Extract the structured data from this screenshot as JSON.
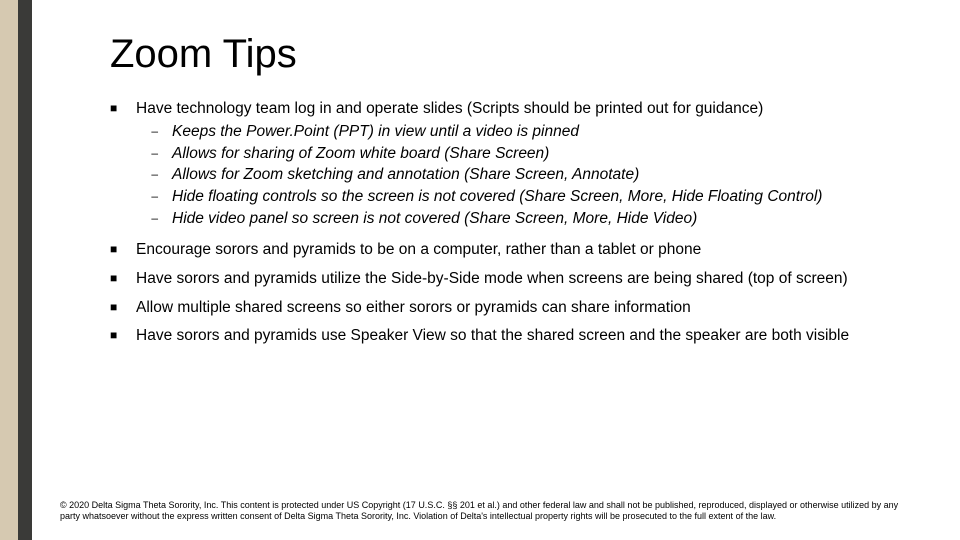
{
  "title": "Zoom Tips",
  "bullets": [
    {
      "text": "Have technology team log in and operate slides (Scripts should be printed out for guidance)",
      "sub": [
        "Keeps the Power.Point (PPT) in view until a video is pinned",
        "Allows for sharing of Zoom white board (Share Screen)",
        "Allows for Zoom sketching and annotation (Share Screen, Annotate)",
        "Hide floating controls so the screen is not covered (Share Screen, More, Hide Floating Control)",
        "Hide video panel so screen is not covered (Share Screen, More, Hide Video)"
      ]
    },
    {
      "text": "Encourage sorors and pyramids to be on a computer, rather than a tablet or phone"
    },
    {
      "text": "Have sorors and pyramids utilize the Side-by-Side mode when screens are being shared (top of screen)"
    },
    {
      "text": "Allow multiple shared screens so either sorors or pyramids can share information"
    },
    {
      "text": "Have sorors and pyramids use Speaker View so that the shared screen and the speaker are both visible"
    }
  ],
  "footer": "© 2020 Delta Sigma Theta Sorority, Inc. This content is protected under US Copyright (17 U.S.C. §§ 201 et al.) and other federal law and shall not be published, reproduced, displayed or otherwise utilized by any party whatsoever without the express written consent of Delta Sigma Theta Sorority, Inc. Violation of Delta's intellectual property rights will be prosecuted to the full extent of the law.",
  "markers": {
    "square": "■",
    "dash": "–"
  }
}
